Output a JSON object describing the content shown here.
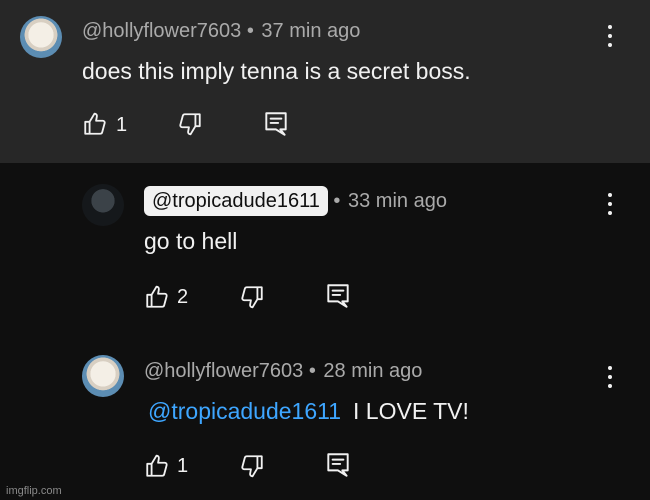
{
  "comments": [
    {
      "handle": "@hollyflower7603",
      "separator": "•",
      "time": "37 min ago",
      "text": "does this imply tenna is a secret boss.",
      "likes": "1"
    },
    {
      "handle": "@tropicadude1611",
      "separator": "•",
      "time": "33 min ago",
      "text": "go to hell",
      "likes": "2"
    },
    {
      "handle": "@hollyflower7603",
      "separator": "•",
      "time": "28 min ago",
      "mention": "@tropicadude1611",
      "text": "I LOVE TV!",
      "likes": "1"
    }
  ],
  "watermark": "imgflip.com"
}
